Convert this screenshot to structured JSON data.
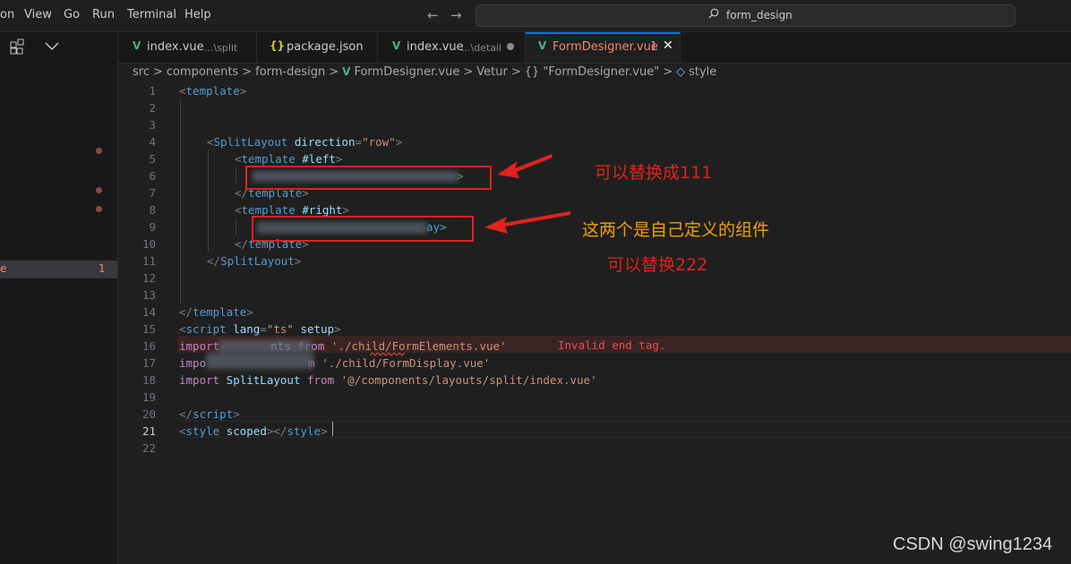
{
  "menu": {
    "items": [
      "on",
      "View",
      "Go",
      "Run",
      "Terminal",
      "Help"
    ]
  },
  "search": {
    "text": "form_design"
  },
  "sidebar": {
    "selected_label": "e",
    "selected_count": "1"
  },
  "tabs": [
    {
      "label": "index.vue",
      "hint": "...\\split",
      "icon": "vue-icon"
    },
    {
      "label": "package.json",
      "icon": "json-icon"
    },
    {
      "label": "index.vue",
      "hint": "...\\detail",
      "icon": "vue-icon"
    },
    {
      "label": "FormDesigner.vue",
      "badge": "1",
      "icon": "vue-icon"
    }
  ],
  "breadcrumb": [
    "src",
    ">",
    "components",
    ">",
    "form-design",
    ">",
    "FormDesigner.vue",
    ">",
    "Vetur",
    ">",
    "{} \"FormDesigner.vue\"",
    ">",
    "style"
  ],
  "line_numbers": [
    "1",
    "2",
    "3",
    "4",
    "5",
    "6",
    "7",
    "8",
    "9",
    "10",
    "11",
    "12",
    "13",
    "14",
    "15",
    "16",
    "17",
    "18",
    "19",
    "20",
    "21",
    "22"
  ],
  "current_line": "21",
  "code": {
    "l1": {
      "a": "<",
      "b": "template",
      "c": ">"
    },
    "l4": {
      "a": "<",
      "b": "SplitLayout",
      "c": " direction",
      "d": "=",
      "e": "\"row\"",
      "f": ">"
    },
    "l5": {
      "a": "<",
      "b": "template",
      "c": " #left",
      "d": ">"
    },
    "l6": {
      "a": ">"
    },
    "l7": {
      "a": "</",
      "b": "template",
      "c": ">"
    },
    "l8": {
      "a": "<",
      "b": "template",
      "c": " #right",
      "d": ">"
    },
    "l9": {
      "a": "ay>"
    },
    "l10": {
      "a": "</",
      "b": "template",
      "c": ">"
    },
    "l11": {
      "a": "</",
      "b": "SplitLayout",
      "c": ">"
    },
    "l14": {
      "a": "</",
      "b": "template",
      "c": ">"
    },
    "l15": {
      "a": "<",
      "b": "script",
      "c": " lang",
      "d": "=",
      "e": "\"ts\"",
      "f": " setup",
      "g": ">"
    },
    "l16": {
      "a": "import",
      "b": "nts",
      "c": " from ",
      "d": "'./child/FormElements.vue'"
    },
    "l17": {
      "a": "impo",
      "b": "m ",
      "c": "'./child/FormDisplay.vue'"
    },
    "l18": {
      "a": "import",
      "b": " SplitLayout",
      "c": " from ",
      "d": "'@/components/layouts/split/index.vue'"
    },
    "l20": {
      "a": "</",
      "b": "script",
      "c": ">"
    },
    "l21": {
      "a": "<",
      "b": "style",
      "c": " scoped",
      "d": "></",
      "e": "style",
      "f": ">"
    }
  },
  "error_message": "Invalid end tag.",
  "annotations": {
    "one": "可以替换成111",
    "two": "这两个是自己定义的组件",
    "three": "可以替换222"
  },
  "colors": {
    "annotation": "#e0231c",
    "annotation_alt": "#f0a000",
    "accent": "#0078d4",
    "vue": "#41b883"
  },
  "watermark": "CSDN @swing1234"
}
